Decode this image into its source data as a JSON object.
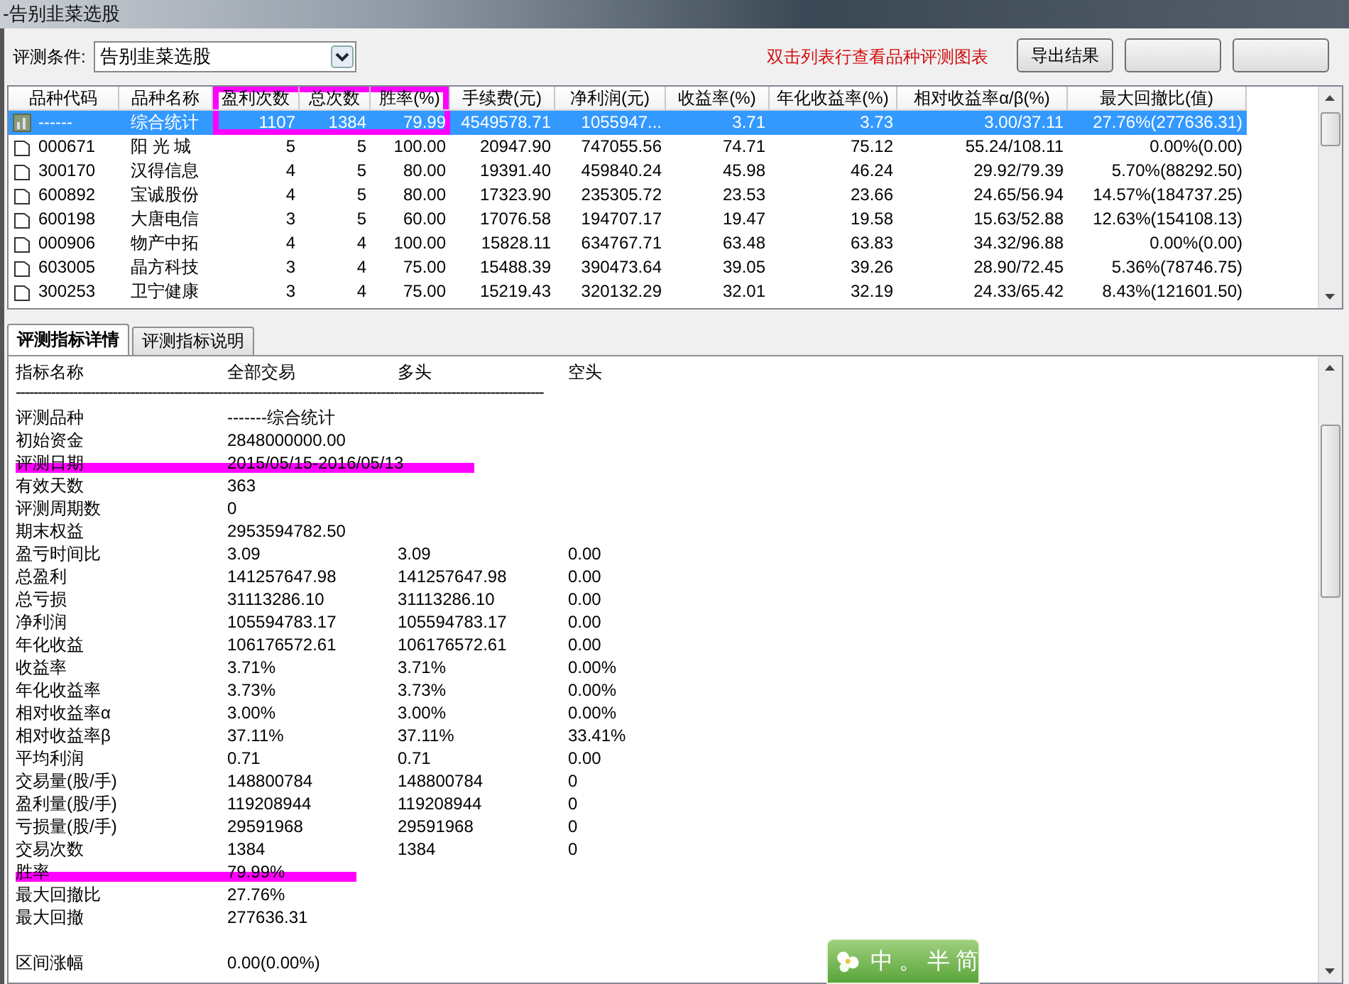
{
  "window": {
    "title": "-告别韭菜选股"
  },
  "toolbar": {
    "label": "评测条件:",
    "condition": "告别韭菜选股",
    "hint": "双击列表行查看品种评测图表",
    "buttons": [
      {
        "kind": "text",
        "label": "导出结果"
      },
      {
        "kind": "covered"
      },
      {
        "kind": "covered"
      }
    ]
  },
  "table": {
    "columns": [
      {
        "label": "品种代码",
        "highlighted": false
      },
      {
        "label": "品种名称",
        "highlighted": false
      },
      {
        "label": "盈利次数",
        "highlighted": true
      },
      {
        "label": "总次数",
        "highlighted": true
      },
      {
        "label": "胜率(%)",
        "highlighted": true
      },
      {
        "label": "手续费(元)",
        "highlighted": false
      },
      {
        "label": "净利润(元)",
        "highlighted": false
      },
      {
        "label": "收益率(%)",
        "highlighted": false
      },
      {
        "label": "年化收益率(%)",
        "highlighted": false
      },
      {
        "label": "相对收益率α/β(%)",
        "highlighted": false
      },
      {
        "label": "最大回撤比(值)",
        "highlighted": false
      }
    ],
    "rows": [
      {
        "kind": "summary",
        "selected": true,
        "cells": [
          "------",
          "综合统计",
          "1107",
          "1384",
          "79.99",
          "4549578.71",
          "1055947...",
          "3.71",
          "3.73",
          "3.00/37.11",
          "27.76%(277636.31)"
        ]
      },
      {
        "kind": "stock",
        "selected": false,
        "cells": [
          "000671",
          "阳 光 城",
          "5",
          "5",
          "100.00",
          "20947.90",
          "747055.56",
          "74.71",
          "75.12",
          "55.24/108.11",
          "0.00%(0.00)"
        ]
      },
      {
        "kind": "stock",
        "selected": false,
        "cells": [
          "300170",
          "汉得信息",
          "4",
          "5",
          "80.00",
          "19391.40",
          "459840.24",
          "45.98",
          "46.24",
          "29.92/79.39",
          "5.70%(88292.50)"
        ]
      },
      {
        "kind": "stock",
        "selected": false,
        "cells": [
          "600892",
          "宝诚股份",
          "4",
          "5",
          "80.00",
          "17323.90",
          "235305.72",
          "23.53",
          "23.66",
          "24.65/56.94",
          "14.57%(184737.25)"
        ]
      },
      {
        "kind": "stock",
        "selected": false,
        "cells": [
          "600198",
          "大唐电信",
          "3",
          "5",
          "60.00",
          "17076.58",
          "194707.17",
          "19.47",
          "19.58",
          "15.63/52.88",
          "12.63%(154108.13)"
        ]
      },
      {
        "kind": "stock",
        "selected": false,
        "cells": [
          "000906",
          "物产中拓",
          "4",
          "4",
          "100.00",
          "15828.11",
          "634767.71",
          "63.48",
          "63.83",
          "34.32/96.88",
          "0.00%(0.00)"
        ]
      },
      {
        "kind": "stock",
        "selected": false,
        "cells": [
          "603005",
          "晶方科技",
          "3",
          "4",
          "75.00",
          "15488.39",
          "390473.64",
          "39.05",
          "39.26",
          "28.90/72.45",
          "5.36%(78746.75)"
        ]
      },
      {
        "kind": "stock",
        "selected": false,
        "cells": [
          "300253",
          "卫宁健康",
          "3",
          "4",
          "75.00",
          "15219.43",
          "320132.29",
          "32.01",
          "32.19",
          "24.33/65.42",
          "8.43%(121601.50)"
        ]
      }
    ]
  },
  "tabs": [
    {
      "label": "评测指标详情",
      "selected": true
    },
    {
      "label": "评测指标说明",
      "selected": false
    }
  ],
  "details": {
    "header": [
      "指标名称",
      "全部交易",
      "多头",
      "空头"
    ],
    "separator": "------------------------------------------------------------------------------------------------------------------------",
    "rows": [
      {
        "cells": [
          "评测品种",
          "-------综合统计"
        ],
        "underlined": false
      },
      {
        "cells": [
          "初始资金",
          "2848000000.00"
        ],
        "underlined": false
      },
      {
        "cells": [
          "评测日期",
          "2015/05/15-2016/05/13"
        ],
        "underlined": true
      },
      {
        "cells": [
          "有效天数",
          "363"
        ],
        "underlined": false
      },
      {
        "cells": [
          "评测周期数",
          "0"
        ],
        "underlined": false
      },
      {
        "cells": [
          "期末权益",
          "2953594782.50"
        ],
        "underlined": false
      },
      {
        "cells": [
          "盈亏时间比",
          "3.09",
          "3.09",
          "0.00"
        ],
        "underlined": false
      },
      {
        "cells": [
          "总盈利",
          "141257647.98",
          "141257647.98",
          "0.00"
        ],
        "underlined": false
      },
      {
        "cells": [
          "总亏损",
          "31113286.10",
          "31113286.10",
          "0.00"
        ],
        "underlined": false
      },
      {
        "cells": [
          "净利润",
          "105594783.17",
          "105594783.17",
          "0.00"
        ],
        "underlined": false
      },
      {
        "cells": [
          "年化收益",
          "106176572.61",
          "106176572.61",
          "0.00"
        ],
        "underlined": false
      },
      {
        "cells": [
          "收益率",
          "3.71%",
          "3.71%",
          "0.00%"
        ],
        "underlined": false
      },
      {
        "cells": [
          "年化收益率",
          "3.73%",
          "3.73%",
          "0.00%"
        ],
        "underlined": false
      },
      {
        "cells": [
          "相对收益率α",
          "3.00%",
          "3.00%",
          "0.00%"
        ],
        "underlined": false
      },
      {
        "cells": [
          "相对收益率β",
          "37.11%",
          "37.11%",
          "33.41%"
        ],
        "underlined": false
      },
      {
        "cells": [
          "平均利润",
          "0.71",
          "0.71",
          "0.00"
        ],
        "underlined": false
      },
      {
        "cells": [
          "交易量(股/手)",
          "148800784",
          "148800784",
          "0"
        ],
        "underlined": false
      },
      {
        "cells": [
          "盈利量(股/手)",
          "119208944",
          "119208944",
          "0"
        ],
        "underlined": false
      },
      {
        "cells": [
          "亏损量(股/手)",
          "29591968",
          "29591968",
          "0"
        ],
        "underlined": false
      },
      {
        "cells": [
          "交易次数",
          "1384",
          "1384",
          "0"
        ],
        "underlined": false
      },
      {
        "cells": [
          "胜率",
          "79.99%"
        ],
        "underlined": true
      },
      {
        "cells": [
          "最大回撤比",
          "27.76%"
        ],
        "underlined": false
      },
      {
        "cells": [
          "最大回撤",
          "277636.31"
        ],
        "underlined": false
      },
      {
        "cells": []
      },
      {
        "cells": [
          "区间涨幅",
          "0.00(0.00%)"
        ],
        "underlined": false
      }
    ]
  },
  "ime_bar": {
    "items": [
      "中",
      "。",
      "半",
      "简"
    ]
  }
}
